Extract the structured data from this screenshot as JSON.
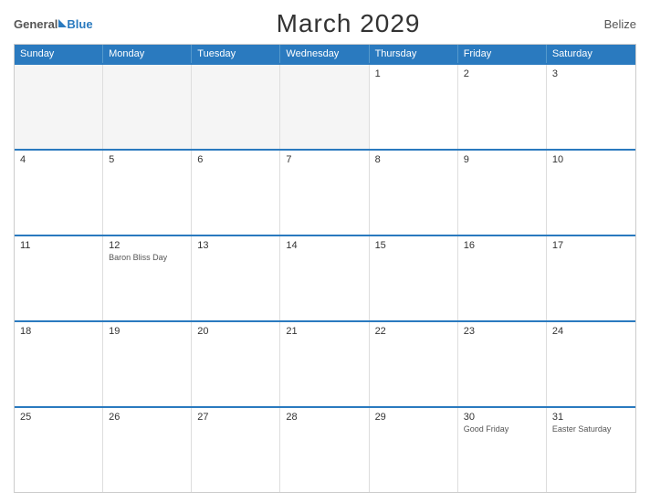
{
  "header": {
    "logo": {
      "general": "General",
      "blue": "Blue"
    },
    "title": "March 2029",
    "country": "Belize"
  },
  "dayHeaders": [
    "Sunday",
    "Monday",
    "Tuesday",
    "Wednesday",
    "Thursday",
    "Friday",
    "Saturday"
  ],
  "weeks": [
    [
      {
        "day": "",
        "empty": true
      },
      {
        "day": "",
        "empty": true
      },
      {
        "day": "",
        "empty": true
      },
      {
        "day": "",
        "empty": true
      },
      {
        "day": "1",
        "empty": false,
        "holiday": ""
      },
      {
        "day": "2",
        "empty": false,
        "holiday": ""
      },
      {
        "day": "3",
        "empty": false,
        "holiday": ""
      }
    ],
    [
      {
        "day": "4",
        "empty": false,
        "holiday": ""
      },
      {
        "day": "5",
        "empty": false,
        "holiday": ""
      },
      {
        "day": "6",
        "empty": false,
        "holiday": ""
      },
      {
        "day": "7",
        "empty": false,
        "holiday": ""
      },
      {
        "day": "8",
        "empty": false,
        "holiday": ""
      },
      {
        "day": "9",
        "empty": false,
        "holiday": ""
      },
      {
        "day": "10",
        "empty": false,
        "holiday": ""
      }
    ],
    [
      {
        "day": "11",
        "empty": false,
        "holiday": ""
      },
      {
        "day": "12",
        "empty": false,
        "holiday": "Baron Bliss Day"
      },
      {
        "day": "13",
        "empty": false,
        "holiday": ""
      },
      {
        "day": "14",
        "empty": false,
        "holiday": ""
      },
      {
        "day": "15",
        "empty": false,
        "holiday": ""
      },
      {
        "day": "16",
        "empty": false,
        "holiday": ""
      },
      {
        "day": "17",
        "empty": false,
        "holiday": ""
      }
    ],
    [
      {
        "day": "18",
        "empty": false,
        "holiday": ""
      },
      {
        "day": "19",
        "empty": false,
        "holiday": ""
      },
      {
        "day": "20",
        "empty": false,
        "holiday": ""
      },
      {
        "day": "21",
        "empty": false,
        "holiday": ""
      },
      {
        "day": "22",
        "empty": false,
        "holiday": ""
      },
      {
        "day": "23",
        "empty": false,
        "holiday": ""
      },
      {
        "day": "24",
        "empty": false,
        "holiday": ""
      }
    ],
    [
      {
        "day": "25",
        "empty": false,
        "holiday": ""
      },
      {
        "day": "26",
        "empty": false,
        "holiday": ""
      },
      {
        "day": "27",
        "empty": false,
        "holiday": ""
      },
      {
        "day": "28",
        "empty": false,
        "holiday": ""
      },
      {
        "day": "29",
        "empty": false,
        "holiday": ""
      },
      {
        "day": "30",
        "empty": false,
        "holiday": "Good Friday"
      },
      {
        "day": "31",
        "empty": false,
        "holiday": "Easter Saturday"
      }
    ]
  ]
}
